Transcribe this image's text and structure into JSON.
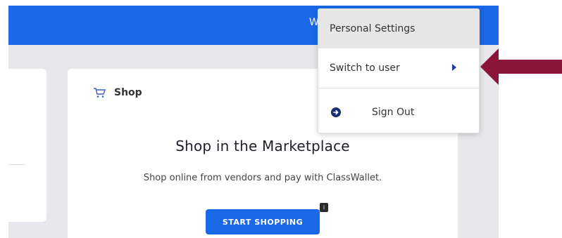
{
  "topbar": {
    "user_partial": "W"
  },
  "shop_card": {
    "header_label": "Shop",
    "title": "Shop in the Marketplace",
    "description": "Shop online from vendors and pay with ClassWallet.",
    "button_label": "START SHOPPING",
    "badge_text": "i"
  },
  "dropdown": {
    "items": [
      {
        "label": "Personal Settings"
      },
      {
        "label": "Switch to user"
      },
      {
        "label": "Sign Out"
      }
    ]
  },
  "icons": [
    "cart-icon",
    "caret-right-icon",
    "sign-out-icon",
    "pointer-arrow-icon"
  ],
  "colors": {
    "brand_blue": "#1a68e8",
    "arrow_maroon": "#8a1538",
    "dropdown_hover": "#e6e6e6"
  }
}
